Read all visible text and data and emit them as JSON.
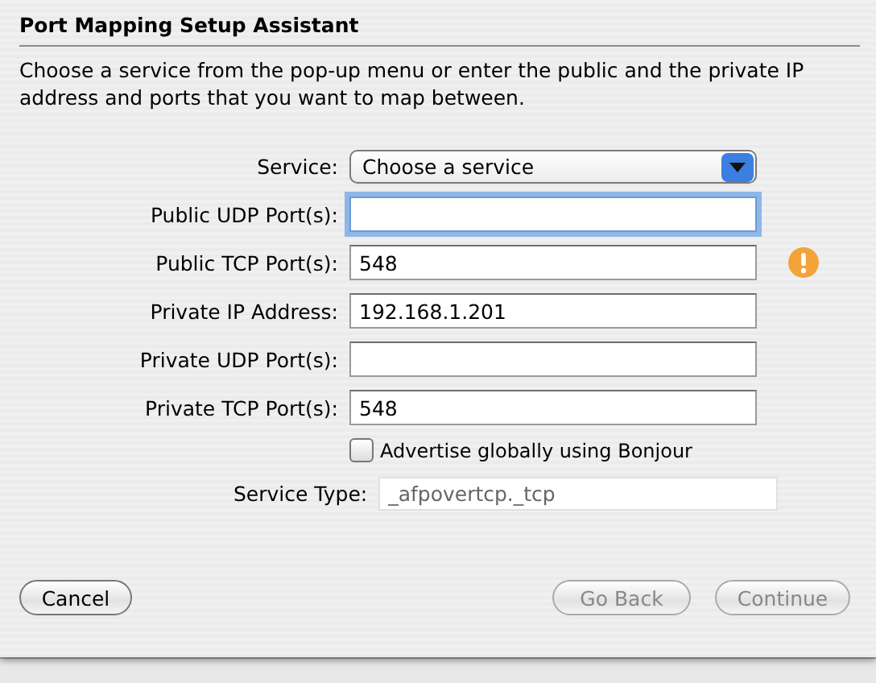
{
  "window": {
    "title": "Port Mapping Setup Assistant"
  },
  "instructions": "Choose a service from the pop-up menu or enter the public and the private IP address and ports that you want to map between.",
  "service": {
    "label": "Service:",
    "value": "Choose a service"
  },
  "fields": [
    {
      "label": "Public UDP Port(s):",
      "focused": true,
      "warning": false
    },
    {
      "label": "Public TCP Port(s):",
      "value": "548",
      "focused": false,
      "warning": true
    },
    {
      "label": "Private IP Address:",
      "value": "192.168.1.201",
      "focused": false,
      "warning": false
    },
    {
      "label": "Private UDP Port(s):",
      "focused": false,
      "warning": false
    },
    {
      "label": "Private TCP Port(s):",
      "value": "548",
      "focused": false,
      "warning": false
    }
  ],
  "bonjour": {
    "label": "Advertise globally using Bonjour",
    "checked": false
  },
  "service_type": {
    "label": "Service Type:",
    "value": "_afpovertcp._tcp",
    "disabled": true
  },
  "buttons": [
    {
      "label": "Cancel",
      "disabled": false
    },
    {
      "label": "Go Back",
      "disabled": true
    },
    {
      "label": "Continue",
      "disabled": true
    }
  ]
}
